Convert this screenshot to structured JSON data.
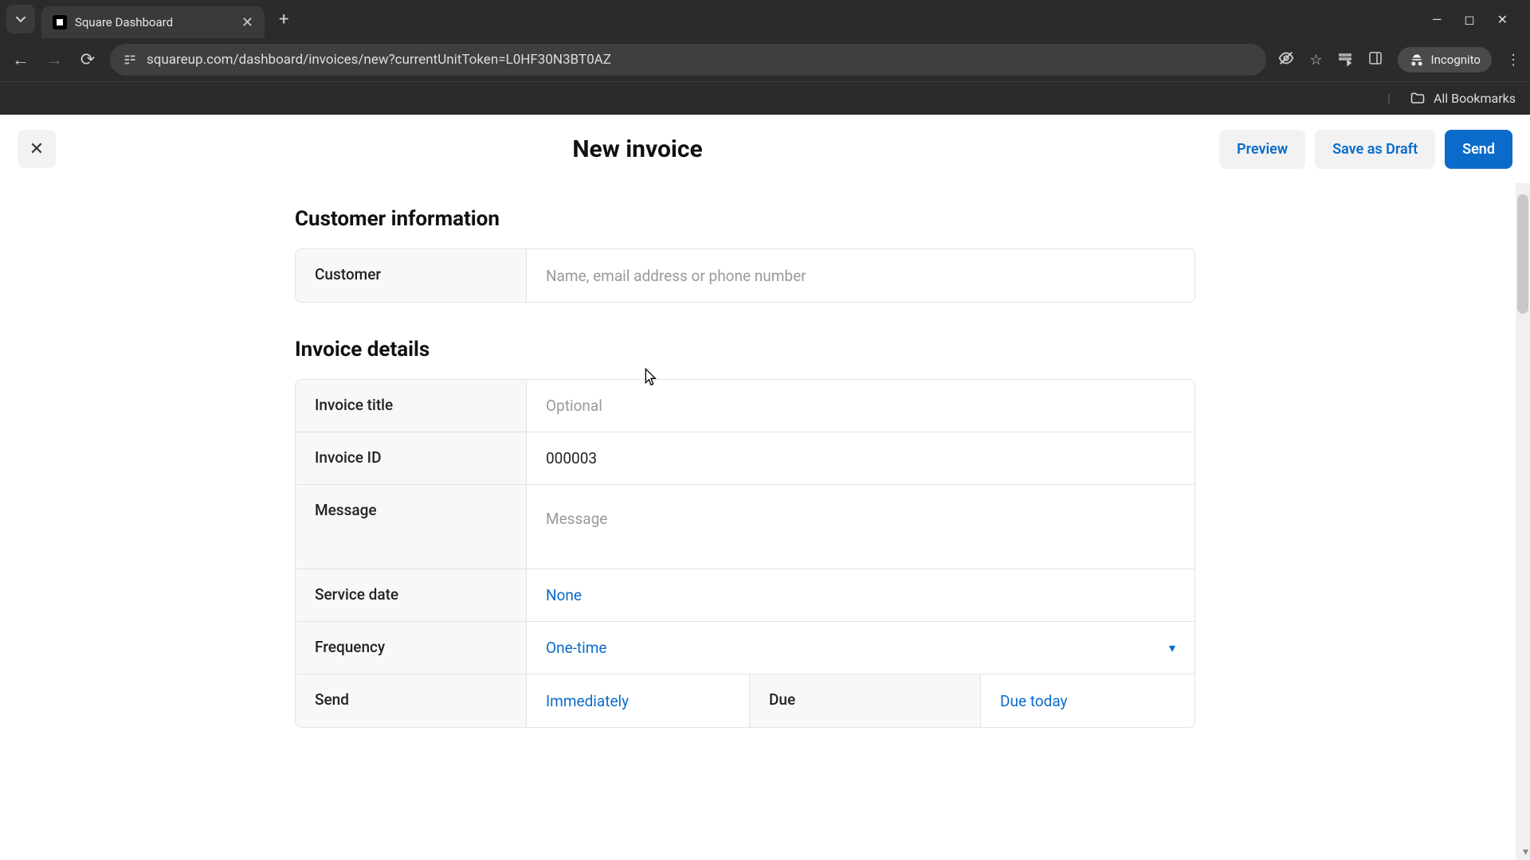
{
  "browser": {
    "tab_title": "Square Dashboard",
    "url": "squareup.com/dashboard/invoices/new?currentUnitToken=L0HF30N3BT0AZ",
    "incognito_label": "Incognito",
    "all_bookmarks": "All Bookmarks"
  },
  "header": {
    "title": "New invoice",
    "preview": "Preview",
    "save_draft": "Save as Draft",
    "send": "Send"
  },
  "sections": {
    "customer_info": {
      "heading": "Customer information",
      "customer_label": "Customer",
      "customer_placeholder": "Name, email address or phone number"
    },
    "invoice_details": {
      "heading": "Invoice details",
      "title_label": "Invoice title",
      "title_placeholder": "Optional",
      "id_label": "Invoice ID",
      "id_value": "000003",
      "message_label": "Message",
      "message_placeholder": "Message",
      "service_date_label": "Service date",
      "service_date_value": "None",
      "frequency_label": "Frequency",
      "frequency_value": "One-time",
      "send_label": "Send",
      "send_value": "Immediately",
      "due_label": "Due",
      "due_value": "Due today"
    }
  }
}
